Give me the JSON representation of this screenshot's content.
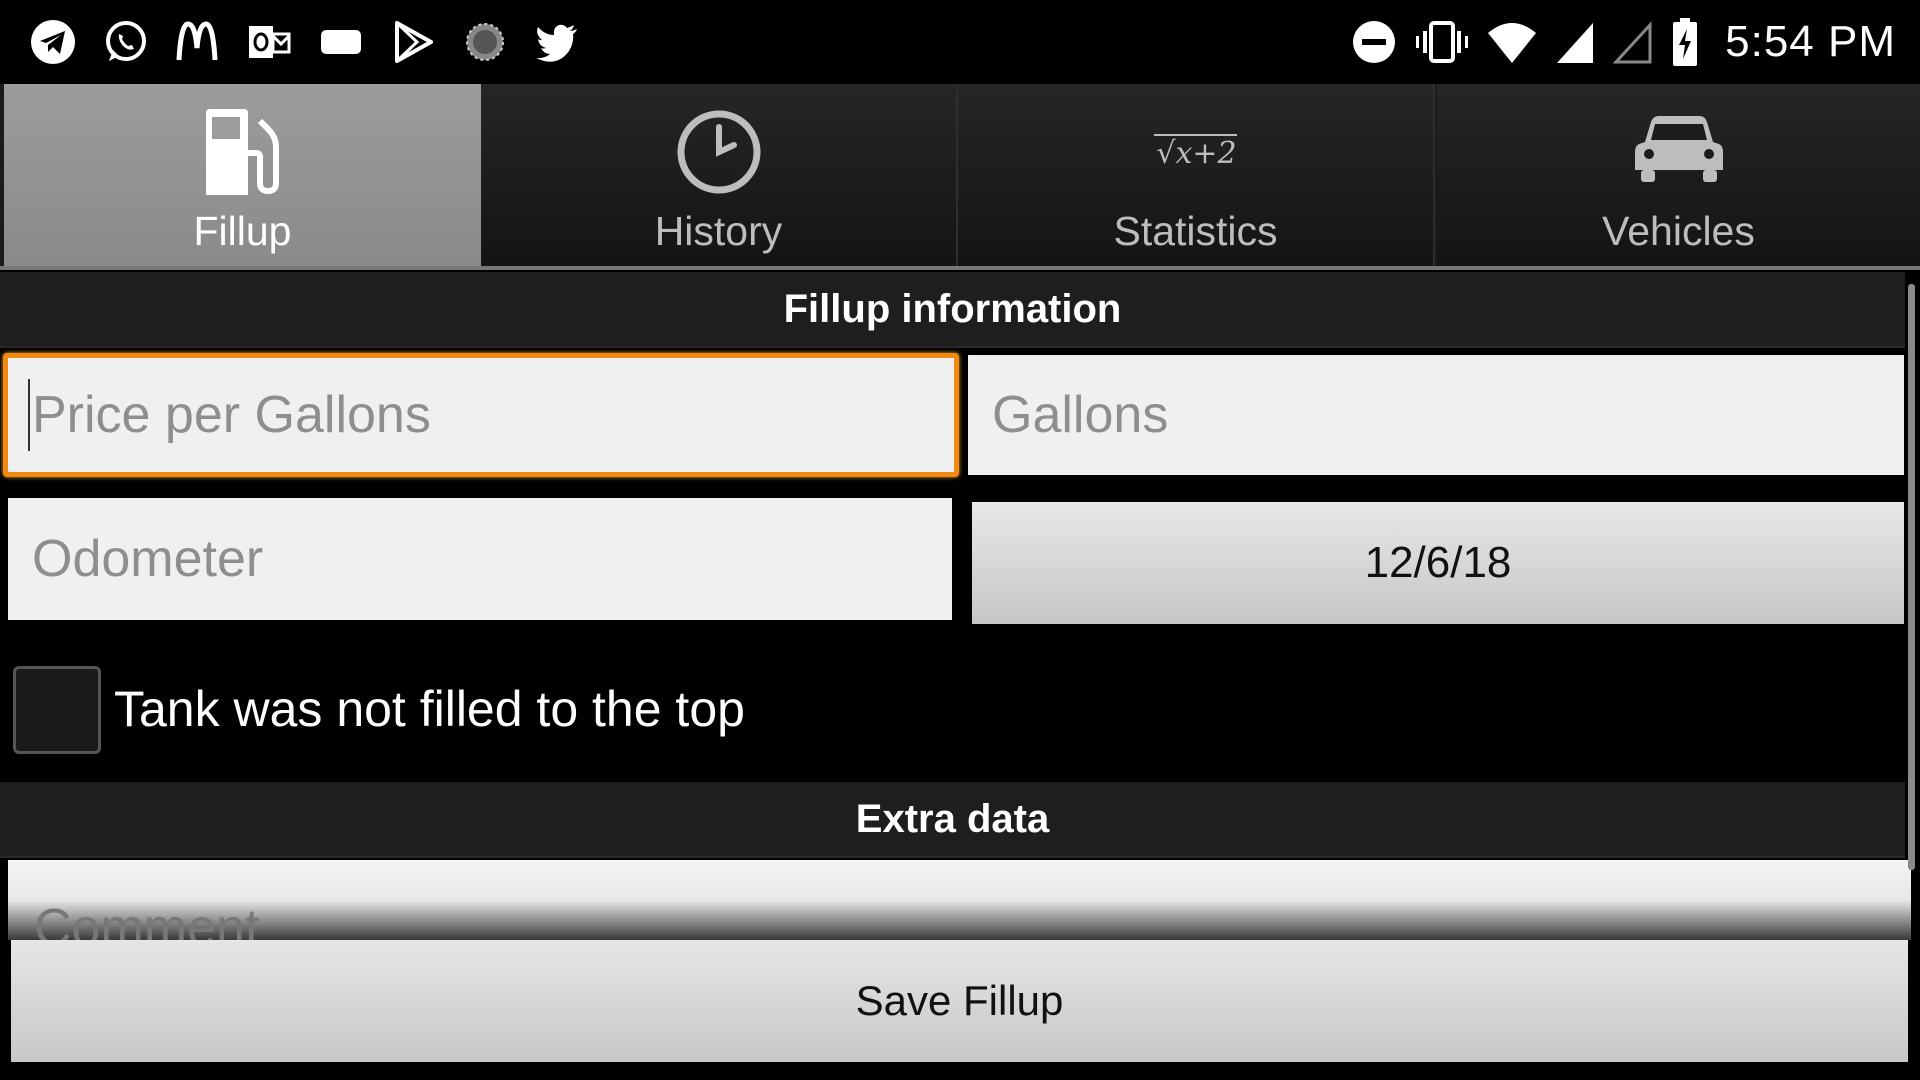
{
  "status_bar": {
    "left_icons": [
      "telegram-icon",
      "whatsapp-icon",
      "mcdonalds-icon",
      "outlook-icon",
      "message-icon",
      "play-store-icon",
      "loading-icon",
      "twitter-icon"
    ],
    "right_icons": [
      "do-not-disturb-icon",
      "vibrate-icon",
      "wifi-icon",
      "signal-icon",
      "signal-empty-icon",
      "battery-charging-icon"
    ],
    "time": "5:54 PM"
  },
  "tabs": [
    {
      "label": "Fillup",
      "icon": "fuel-pump-icon",
      "active": true
    },
    {
      "label": "History",
      "icon": "clock-icon",
      "active": false
    },
    {
      "label": "Statistics",
      "icon": "sqrt-formula-icon",
      "active": false,
      "icon_text": "√x+2"
    },
    {
      "label": "Vehicles",
      "icon": "car-icon",
      "active": false
    }
  ],
  "fillup_section": {
    "title": "Fillup information",
    "price_placeholder": "Price per Gallons",
    "gallons_placeholder": "Gallons",
    "odometer_placeholder": "Odometer",
    "date_value": "12/6/18",
    "partial_fill_label": "Tank was not filled to the top",
    "partial_fill_checked": false
  },
  "extra_section": {
    "title": "Extra data",
    "comment_placeholder": "Comment"
  },
  "save_button_label": "Save Fillup",
  "colors": {
    "focus_border": "#f08a10",
    "active_tab": "#9c9c9c"
  }
}
